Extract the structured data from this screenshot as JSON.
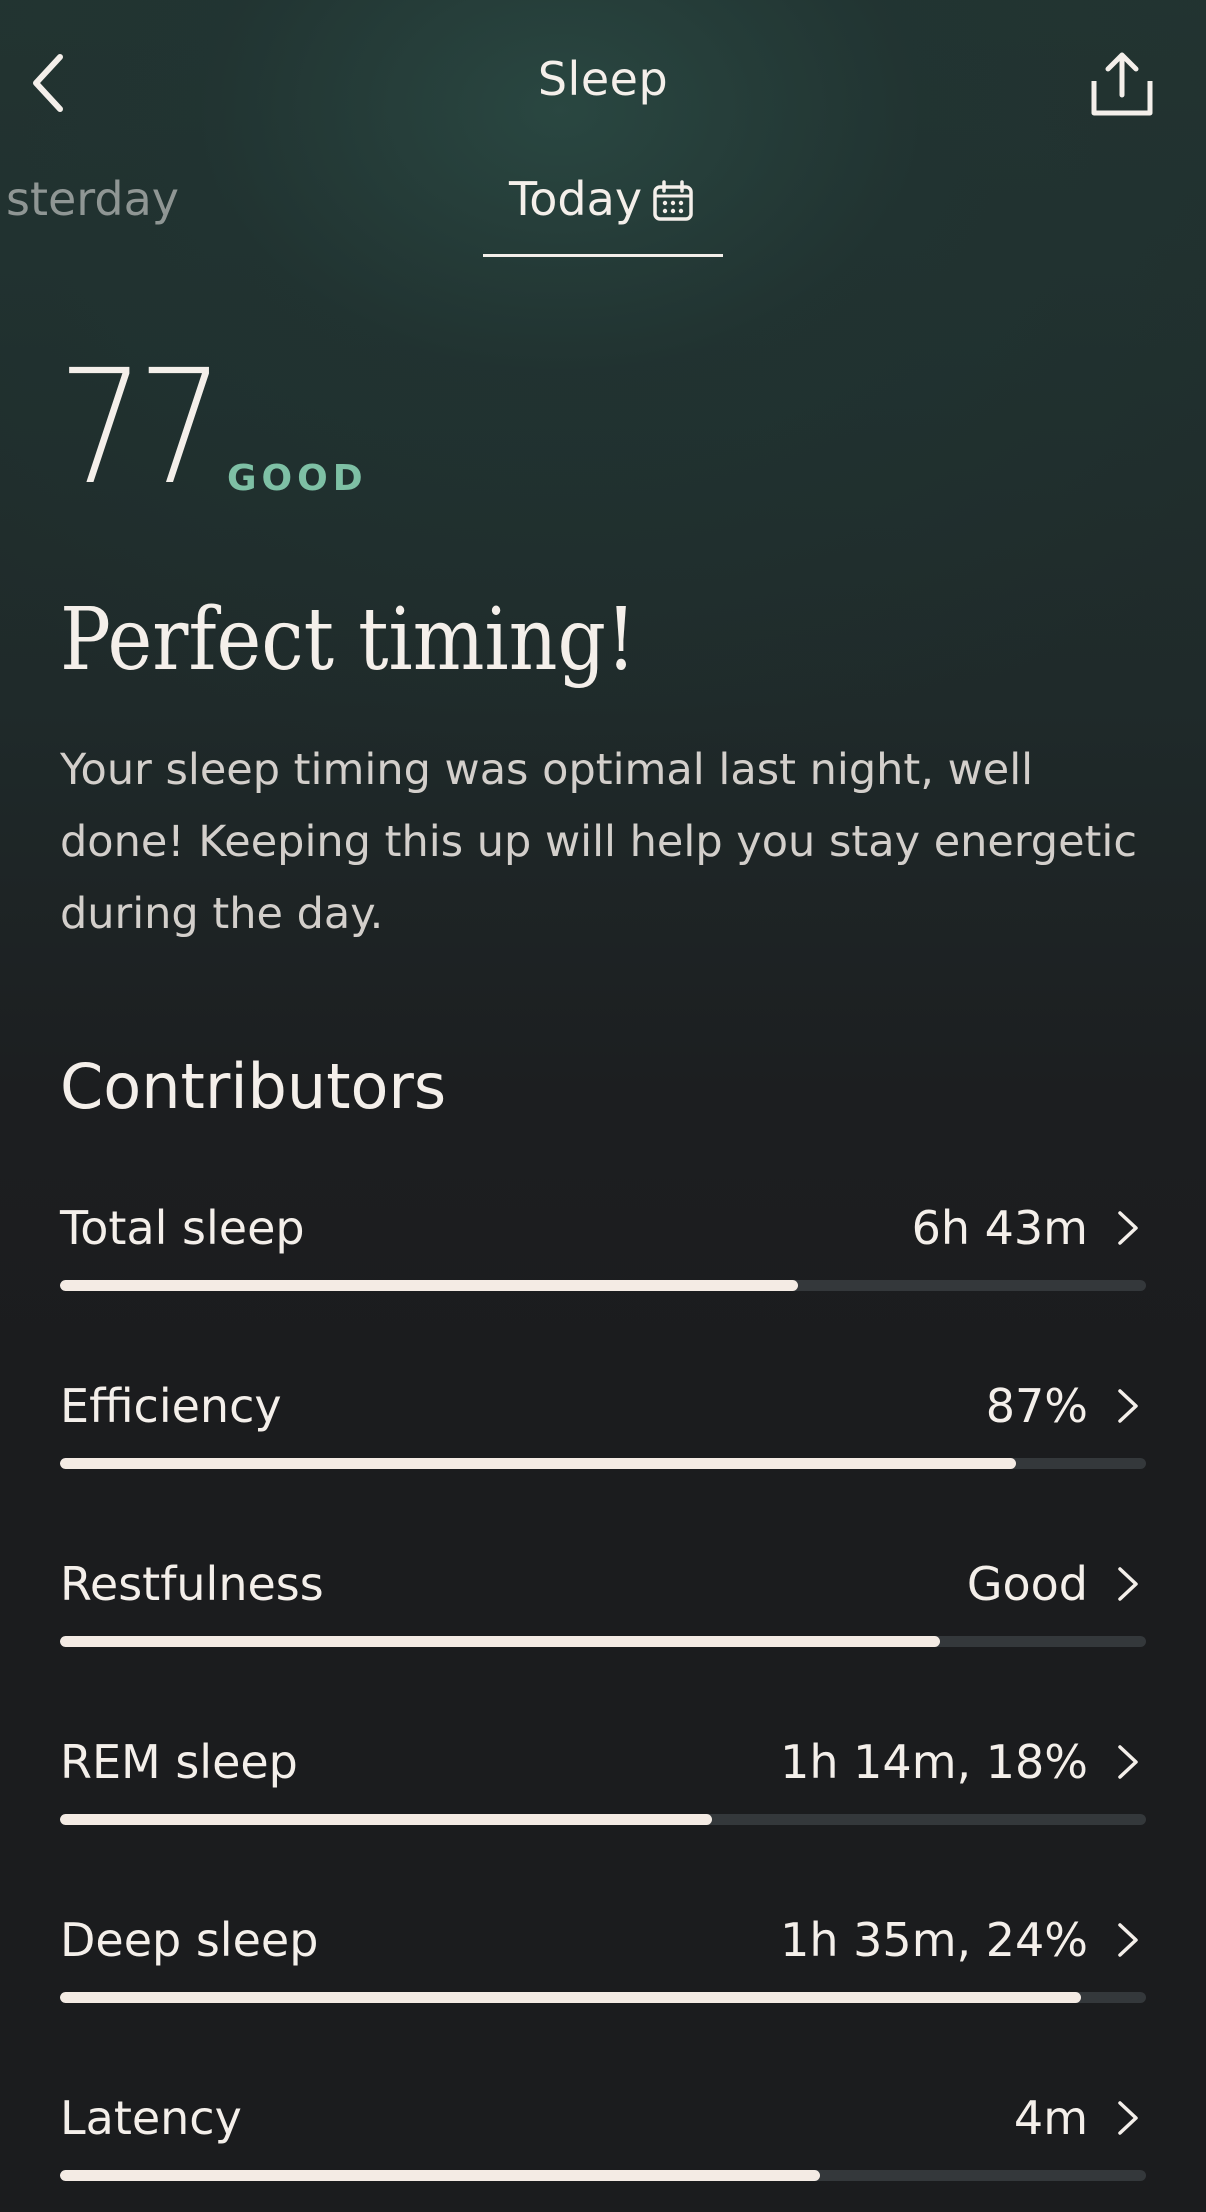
{
  "header": {
    "title": "Sleep",
    "back_icon": "chevron-left-icon",
    "share_icon": "share-icon"
  },
  "tabs": {
    "previous_label": "sterday",
    "current_label": "Today",
    "current_icon": "calendar-icon"
  },
  "score": {
    "value": "77",
    "rating": "GOOD",
    "rating_color": "#7ec0a5"
  },
  "insight": {
    "title": "Perfect timing!",
    "body": "Your sleep timing was optimal last night, well done! Keeping this up will help you stay energetic during the day."
  },
  "contributors": {
    "heading": "Contributors",
    "items": [
      {
        "label": "Total sleep",
        "value": "6h 43m",
        "level": 0.68
      },
      {
        "label": "Efficiency",
        "value": "87%",
        "level": 0.88
      },
      {
        "label": "Restfulness",
        "value": "Good",
        "level": 0.81
      },
      {
        "label": "REM sleep",
        "value": "1h 14m, 18%",
        "level": 0.6
      },
      {
        "label": "Deep sleep",
        "value": "1h 35m, 24%",
        "level": 0.94
      },
      {
        "label": "Latency",
        "value": "4m",
        "level": 0.7
      }
    ]
  },
  "colors": {
    "bar_fill": "#f4ebe4",
    "bar_track": "#34383b",
    "text_primary": "#f4efea"
  }
}
